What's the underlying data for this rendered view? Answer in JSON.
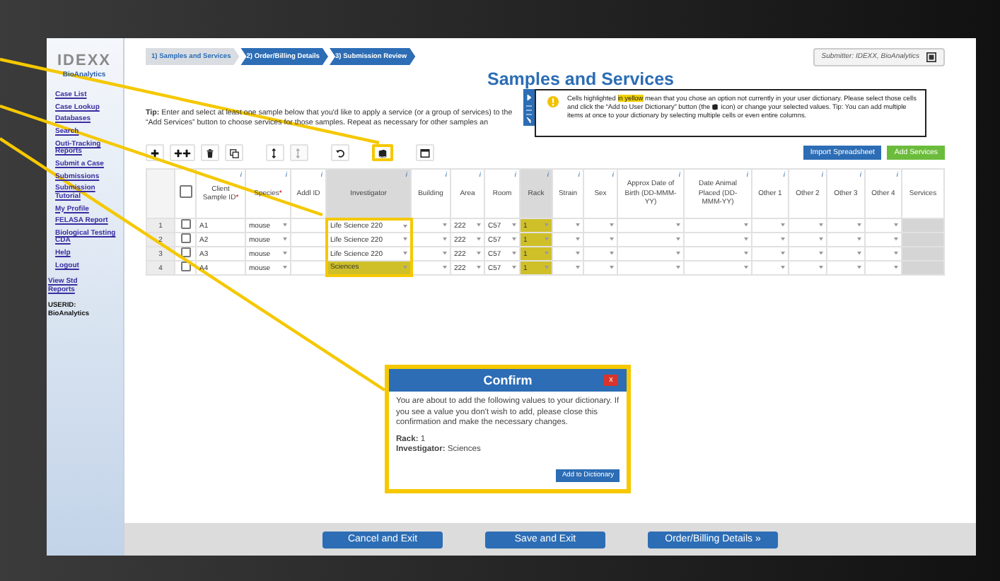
{
  "sidebar": {
    "logo": "IDEXX",
    "logo_sub": "BioAnalytics",
    "links": [
      {
        "label": "Case List"
      },
      {
        "label": "Case Lookup"
      },
      {
        "label": "Databases"
      },
      {
        "label": "Search"
      },
      {
        "label": "Outi-Tracking Reports"
      },
      {
        "label": "Submit a Case"
      },
      {
        "label": "Submissions"
      },
      {
        "label": "Submission Tutorial"
      },
      {
        "label": "My Profile"
      },
      {
        "label": "FELASA Report"
      },
      {
        "label": "Biological Testing CDA"
      },
      {
        "label": "Help"
      },
      {
        "label": "Logout"
      }
    ],
    "report_link": "View Std Reports",
    "user_label": "USERID:",
    "user_name": "BioAnalytics"
  },
  "steps": [
    {
      "label": "1) Samples and Services",
      "selected": true
    },
    {
      "label": "2) Order/Billing Details",
      "selected": false
    },
    {
      "label": "3) Submission Review",
      "selected": false
    }
  ],
  "submitter": "Submitter: IDEXX, BioAnalytics",
  "title": "Samples and Services",
  "tip": "**Tip:** Enter and select at least one sample below that you'd like to apply a service (or a group of services) to the “Add Services” button to choose services for those samples. Repeat as necessary for other samples an",
  "notice": {
    "text_start": "Cells highlighted",
    "highlight": "in yellow",
    "text_middle": "mean that you chose an option not currently in your user dictionary. Please select those cells and click the “Add to User Dictionary” button (the",
    "text_end": "icon) or change your selected values. Tip: You can add multiple items at once to your dictionary by selecting multiple cells or even entire columns."
  },
  "toolbar": [
    {
      "buttons": [
        {
          "kind": "plus",
          "disabled": false,
          "callout": false
        },
        {
          "kind": "double-plus",
          "disabled": false,
          "callout": false
        },
        {
          "kind": "trash",
          "disabled": false,
          "callout": false
        },
        {
          "kind": "copy",
          "disabled": false,
          "callout": false
        }
      ]
    },
    {
      "buttons": [
        {
          "kind": "sort",
          "disabled": false,
          "callout": false
        },
        {
          "kind": "sort",
          "disabled": true,
          "callout": false
        }
      ]
    },
    {
      "buttons": [
        {
          "kind": "undo",
          "disabled": false,
          "callout": false
        }
      ]
    },
    {
      "buttons": [
        {
          "kind": "dictionary",
          "disabled": false,
          "callout": true
        }
      ]
    },
    {
      "buttons": [
        {
          "kind": "window",
          "disabled": false,
          "callout": false
        }
      ]
    }
  ],
  "actions": [
    {
      "label": "Import Spreadsheet",
      "kind": "primary"
    },
    {
      "label": "Add Services",
      "kind": "success"
    }
  ],
  "table": {
    "select_all": {
      "checked": false
    },
    "columns": [
      {
        "kind": "text",
        "label": "Client Sample ID",
        "required_mark": "*",
        "info": "i",
        "selected": false,
        "callout": false
      },
      {
        "kind": "dropdown",
        "label": "Species",
        "required_mark": "*",
        "info": "i",
        "selected": false,
        "callout": false
      },
      {
        "kind": "text",
        "label": "Addl ID",
        "info": "i",
        "selected": false,
        "callout": false
      },
      {
        "kind": "dropdown",
        "label": "Investigator",
        "info": "i",
        "selected": true,
        "callout": true
      },
      {
        "kind": "dropdown",
        "label": "Building",
        "info": "i",
        "selected": false,
        "callout": false
      },
      {
        "kind": "dropdown",
        "label": "Area",
        "info": "i",
        "selected": false,
        "callout": false
      },
      {
        "kind": "dropdown",
        "label": "Room",
        "info": "i",
        "selected": false,
        "callout": false
      },
      {
        "kind": "dropdown",
        "label": "Rack",
        "info": "i",
        "selected": true,
        "callout": false
      },
      {
        "kind": "dropdown",
        "label": "Strain",
        "info": "i",
        "selected": false,
        "callout": false
      },
      {
        "kind": "dropdown",
        "label": "Sex",
        "info": "i",
        "selected": false,
        "callout": false
      },
      {
        "kind": "dropdown",
        "label": "Approx Date of Birth (DD-MMM-YY)",
        "info": "i",
        "selected": false,
        "callout": false
      },
      {
        "kind": "dropdown",
        "label": "Date Animal Placed (DD-MMM-YY)",
        "info": "i",
        "selected": false,
        "callout": false
      },
      {
        "kind": "dropdown",
        "label": "Other 1",
        "info": "i",
        "selected": false,
        "callout": false
      },
      {
        "kind": "dropdown",
        "label": "Other 2",
        "info": "i",
        "selected": false,
        "callout": false
      },
      {
        "kind": "dropdown",
        "label": "Other 3",
        "info": "i",
        "selected": false,
        "callout": false
      },
      {
        "kind": "dropdown",
        "label": "Other 4",
        "info": "i",
        "selected": false,
        "callout": false
      },
      {
        "kind": "services",
        "label": "Services",
        "selected": false,
        "callout": false
      }
    ],
    "rows": [
      {
        "number": "1",
        "checked": false,
        "cells": [
          {
            "value": "A1",
            "highlighted": false
          },
          {
            "value": "mouse",
            "highlighted": false
          },
          {
            "highlighted": false
          },
          {
            "value": "Life Science 220",
            "highlighted": false
          },
          {
            "highlighted": false
          },
          {
            "value": "222",
            "highlighted": false
          },
          {
            "value": "C57",
            "highlighted": false
          },
          {
            "value": "1",
            "highlighted": true
          },
          {
            "highlighted": false
          },
          {
            "highlighted": false
          },
          {
            "highlighted": false
          },
          {
            "highlighted": false
          },
          {
            "highlighted": false
          },
          {
            "highlighted": false
          },
          {
            "highlighted": false
          },
          {
            "highlighted": false
          },
          {
            "highlighted": false
          }
        ]
      },
      {
        "number": "2",
        "checked": false,
        "cells": [
          {
            "value": "A2",
            "highlighted": false
          },
          {
            "value": "mouse",
            "highlighted": false
          },
          {
            "highlighted": false
          },
          {
            "value": "Life Science 220",
            "highlighted": false
          },
          {
            "highlighted": false
          },
          {
            "value": "222",
            "highlighted": false
          },
          {
            "value": "C57",
            "highlighted": false
          },
          {
            "value": "1",
            "highlighted": true
          },
          {
            "highlighted": false
          },
          {
            "highlighted": false
          },
          {
            "highlighted": false
          },
          {
            "highlighted": false
          },
          {
            "highlighted": false
          },
          {
            "highlighted": false
          },
          {
            "highlighted": false
          },
          {
            "highlighted": false
          },
          {
            "highlighted": false
          }
        ]
      },
      {
        "number": "3",
        "checked": false,
        "cells": [
          {
            "value": "A3",
            "highlighted": false
          },
          {
            "value": "mouse",
            "highlighted": false
          },
          {
            "highlighted": false
          },
          {
            "value": "Life Science 220",
            "highlighted": false
          },
          {
            "highlighted": false
          },
          {
            "value": "222",
            "highlighted": false
          },
          {
            "value": "C57",
            "highlighted": false
          },
          {
            "value": "1",
            "highlighted": true
          },
          {
            "highlighted": false
          },
          {
            "highlighted": false
          },
          {
            "highlighted": false
          },
          {
            "highlighted": false
          },
          {
            "highlighted": false
          },
          {
            "highlighted": false
          },
          {
            "highlighted": false
          },
          {
            "highlighted": false
          },
          {
            "highlighted": false
          }
        ]
      },
      {
        "number": "4",
        "checked": false,
        "cells": [
          {
            "value": "A4",
            "highlighted": false
          },
          {
            "value": "mouse",
            "highlighted": false
          },
          {
            "highlighted": false
          },
          {
            "value": "Sciences",
            "highlighted": true
          },
          {
            "highlighted": false
          },
          {
            "value": "222",
            "highlighted": false
          },
          {
            "value": "C57",
            "highlighted": false
          },
          {
            "value": "1",
            "highlighted": true
          },
          {
            "highlighted": false
          },
          {
            "highlighted": false
          },
          {
            "highlighted": false
          },
          {
            "highlighted": false
          },
          {
            "highlighted": false
          },
          {
            "highlighted": false
          },
          {
            "highlighted": false
          },
          {
            "highlighted": false
          },
          {
            "highlighted": false
          }
        ]
      }
    ]
  },
  "dialog": {
    "title": "Confirm",
    "close": "x",
    "message": "You are about to add the following values to your dictionary. If you see a value you don't wish to add, please close this confirmation and make the necessary changes.",
    "values": [
      "**Rack:** 1",
      "**Investigator:** Sciences"
    ],
    "button": "Add to Dictionary",
    "callout": true
  },
  "footer": [
    {
      "label": "Cancel and Exit"
    },
    {
      "label": "Save and Exit"
    },
    {
      "label": "Order/Billing Details »"
    }
  ]
}
